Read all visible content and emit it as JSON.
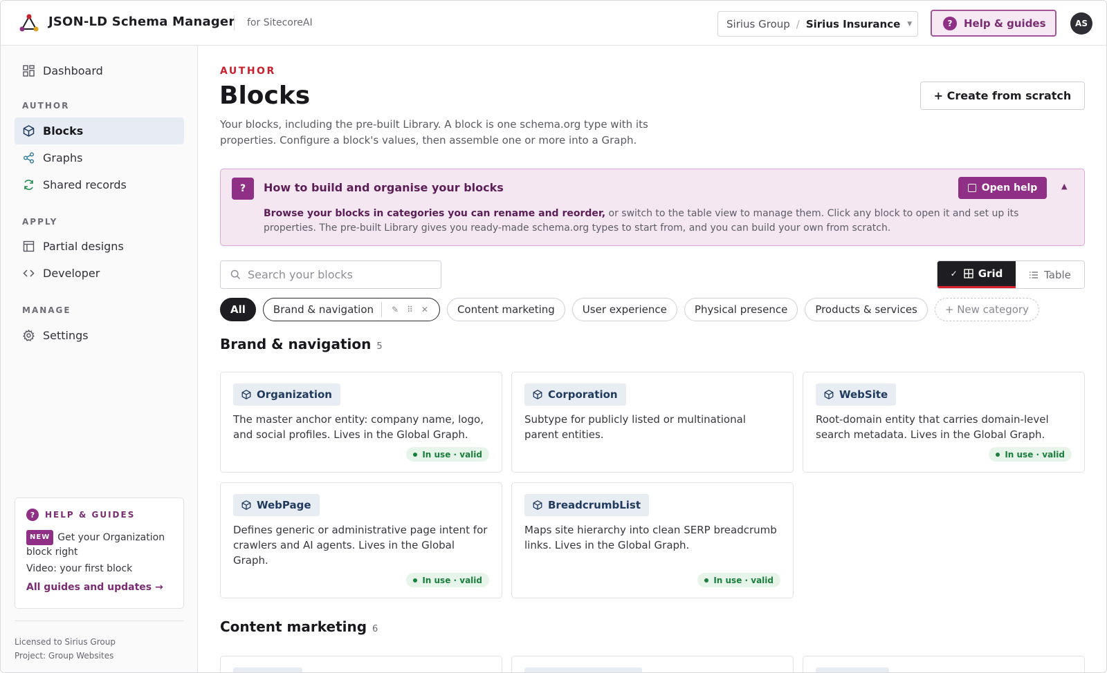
{
  "header": {
    "app_title": "JSON-LD Schema Manager",
    "app_subtitle": "for SitecoreAI",
    "tenant_org": "Sirius Group",
    "tenant_separator": "/",
    "tenant_site": "Sirius Insurance",
    "help_button": "Help & guides",
    "avatar_initials": "AS"
  },
  "sidebar": {
    "dashboard": "Dashboard",
    "sections": {
      "author": "AUTHOR",
      "apply": "APPLY",
      "manage": "MANAGE"
    },
    "items": {
      "blocks": "Blocks",
      "graphs": "Graphs",
      "shared_records": "Shared records",
      "partial_designs": "Partial designs",
      "developer": "Developer",
      "settings": "Settings"
    },
    "help_card": {
      "title": "HELP & GUIDES",
      "new_badge": "NEW",
      "item1": "Get your Organization block right",
      "item2": "Video: your first block",
      "link": "All guides and updates →"
    },
    "license_line1": "Licensed to Sirius Group",
    "license_line2": "Project: Group Websites"
  },
  "main": {
    "eyebrow": "AUTHOR",
    "title": "Blocks",
    "description": "Your blocks, including the pre-built Library. A block is one schema.org type with its properties. Configure a block's values, then assemble one or more into a Graph.",
    "create_button": "+ Create from scratch",
    "help_panel": {
      "title": "How to build and organise your blocks",
      "body_bold": "Browse your blocks in categories you can rename and reorder,",
      "body_rest": " or switch to the table view to manage them. Click any block to open it and set up its properties. The pre-built Library gives you ready-made schema.org types to start from, and you can build your own from scratch.",
      "open_help": "Open help",
      "collapse_icon": "▲"
    },
    "search": {
      "placeholder": "Search your blocks",
      "value": ""
    },
    "view_toggle": {
      "grid_check": "✓",
      "grid": "Grid",
      "table": "Table"
    },
    "categories": {
      "all": "All",
      "brand": "Brand & navigation",
      "content": "Content marketing",
      "ux": "User experience",
      "physical": "Physical presence",
      "products": "Products & services",
      "new": "+ New category"
    },
    "chip_tools": {
      "edit": "✎",
      "drag": "⠿",
      "remove": "✕"
    },
    "section_brand": {
      "title": "Brand & navigation",
      "count": "5"
    },
    "section_content": {
      "title": "Content marketing",
      "count": "6"
    },
    "status_label": "In use · valid",
    "blocks": [
      {
        "name": "Organization",
        "description": "The master anchor entity: company name, logo, and social profiles. Lives in the Global Graph.",
        "status": "In use · valid"
      },
      {
        "name": "Corporation",
        "description": "Subtype for publicly listed or multinational parent entities.",
        "status": ""
      },
      {
        "name": "WebSite",
        "description": "Root-domain entity that carries domain-level search metadata. Lives in the Global Graph.",
        "status": "In use · valid"
      },
      {
        "name": "WebPage",
        "description": "Defines generic or administrative page intent for crawlers and AI agents. Lives in the Global Graph.",
        "status": "In use · valid"
      },
      {
        "name": "BreadcrumbList",
        "description": "Maps site hierarchy into clean SERP breadcrumb links. Lives in the Global Graph.",
        "status": "In use · valid"
      }
    ]
  },
  "colors": {
    "accent_purple": "#8f2f85",
    "eyebrow_red": "#c8202f",
    "status_green": "#1a7f3c",
    "active_nav_bg": "#e6ebf4"
  },
  "icons": {
    "logo": "graph-logo-icon",
    "dashboard": "grid-icon",
    "blocks": "cube-icon",
    "graphs": "share-nodes-icon",
    "shared_records": "refresh-icon",
    "partial_designs": "layout-icon",
    "developer": "code-icon",
    "settings": "gear-icon",
    "search": "search-icon",
    "help": "question-icon"
  }
}
